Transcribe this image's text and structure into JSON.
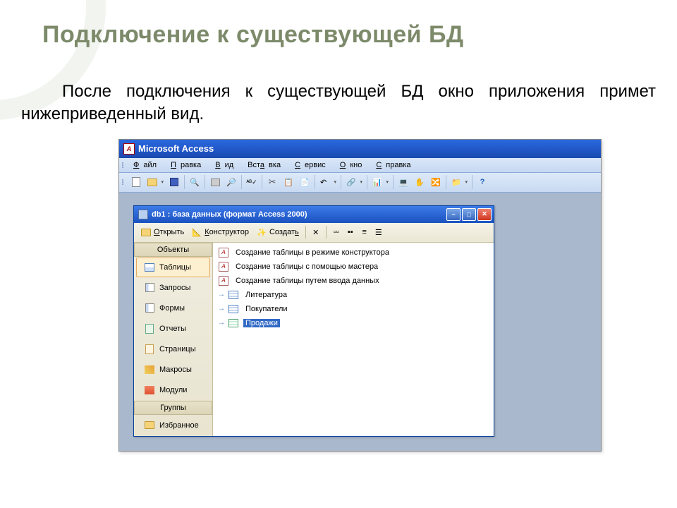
{
  "slide": {
    "title": "Подключение к существующей БД",
    "body": "После подключения к существующей БД окно приложения примет нижеприведенный вид."
  },
  "app": {
    "title": "Microsoft Access",
    "menu": [
      "Файл",
      "Правка",
      "Вид",
      "Вставка",
      "Сервис",
      "Окно",
      "Справка"
    ]
  },
  "dbwin": {
    "title": "db1 : база данных (формат Access 2000)",
    "toolbar": {
      "open": "Открыть",
      "design": "Конструктор",
      "create": "Создать"
    },
    "sidebar": {
      "objects_header": "Объекты",
      "items": [
        {
          "label": "Таблицы"
        },
        {
          "label": "Запросы"
        },
        {
          "label": "Формы"
        },
        {
          "label": "Отчеты"
        },
        {
          "label": "Страницы"
        },
        {
          "label": "Макросы"
        },
        {
          "label": "Модули"
        }
      ],
      "groups_header": "Группы",
      "fav": "Избранное"
    },
    "list": [
      {
        "label": "Создание таблицы в режиме конструктора",
        "type": "new"
      },
      {
        "label": "Создание таблицы с помощью мастера",
        "type": "new"
      },
      {
        "label": "Создание таблицы путем ввода данных",
        "type": "new"
      },
      {
        "label": "Литература",
        "type": "table"
      },
      {
        "label": "Покупатели",
        "type": "table"
      },
      {
        "label": "Продажи",
        "type": "table",
        "selected": true
      }
    ]
  }
}
